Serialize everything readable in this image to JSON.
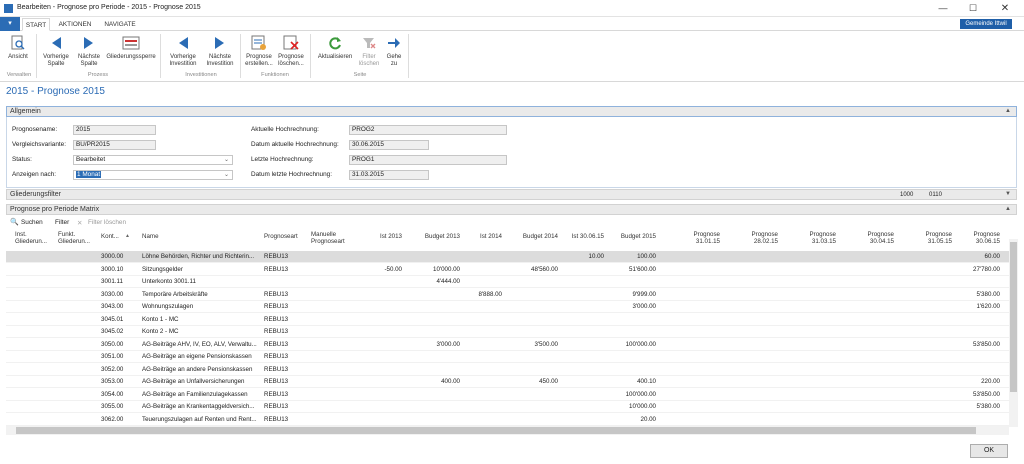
{
  "window": {
    "title": "Bearbeiten - Prognose pro Periode - 2015 - Prognose 2015"
  },
  "ribbon": {
    "tabs": [
      "START",
      "AKTIONEN",
      "NAVIGATE"
    ],
    "company": "Gemeinde Ittwil",
    "buttons": {
      "ansicht": "Ansicht",
      "vorherige_spalte": [
        "Vorherige",
        "Spalte"
      ],
      "naechste_spalte": [
        "Nächste",
        "Spalte"
      ],
      "gliederungssperre": "Gliederungssperre",
      "vorherige_investition": [
        "Vorherige",
        "Investition"
      ],
      "naechste_investition": [
        "Nächste",
        "Investition"
      ],
      "prognose_erstellen": [
        "Prognose",
        "erstellen..."
      ],
      "prognose_loeschen": [
        "Prognose",
        "löschen..."
      ],
      "aktualisieren": "Aktualisieren",
      "filter_loeschen": [
        "Filter",
        "löschen"
      ],
      "gehe_zu": [
        "Gehe",
        "zu"
      ]
    },
    "groups": {
      "verwalten": "Verwalten",
      "prozess": "Prozess",
      "investitionen": "Investitionen",
      "funktionen": "Funktionen",
      "seite": "Seite"
    }
  },
  "page": {
    "title": "2015 - Prognose 2015"
  },
  "allgemein": {
    "section_label": "Allgemein",
    "prognosename_label": "Prognosename:",
    "prognosename": "2015",
    "vergleich_label": "Vergleichsvariante:",
    "vergleich": "BU/PR2015",
    "status_label": "Status:",
    "status": "Bearbeitet",
    "anzeigen_label": "Anzeigen nach:",
    "anzeigen": "1 Monat",
    "aktuelle_label": "Aktuelle Hochrechnung:",
    "aktuelle": "PROG2",
    "datum_aktuelle_label": "Datum aktuelle Hochrechnung:",
    "datum_aktuelle": "30.06.2015",
    "letzte_label": "Letzte Hochrechnung:",
    "letzte": "PROG1",
    "datum_letzte_label": "Datum letzte Hochrechnung:",
    "datum_letzte": "31.03.2015"
  },
  "gliederungsfilter": {
    "label": "Gliederungsfilter",
    "value1": "1000",
    "value2": "0110"
  },
  "matrix": {
    "label": "Prognose pro Periode Matrix",
    "toolbar": {
      "suchen": "Suchen",
      "filter": "Filter",
      "filter_loeschen": "Filter löschen"
    },
    "headers": [
      "Inst. Gliederun...",
      "Funkt. Gliederun...",
      "Kont...",
      "Name",
      "Prognoseart",
      "Manuelle Prognoseart",
      "Ist 2013",
      "Budget 2013",
      "Ist 2014",
      "Budget 2014",
      "Ist 30.06.15",
      "Budget 2015",
      "Prognose 31.01.15",
      "Prognose 28.02.15",
      "Prognose 31.03.15",
      "Prognose 30.04.15",
      "Prognose 31.05.15",
      "Prognose 30.06.15"
    ],
    "rows": [
      {
        "konto": "3000.00",
        "name": "Löhne Behörden, Richter und Richterin...",
        "art": "REBU13",
        "ist13": "",
        "bud13": "",
        "ist14": "",
        "bud14": "",
        "ist15": "10.00",
        "bud15": "100.00",
        "p0615": "60.00",
        "hl": true
      },
      {
        "konto": "3000.10",
        "name": "Sitzungsgelder",
        "art": "REBU13",
        "ist13": "-50.00",
        "bud13": "10'000.00",
        "ist14": "",
        "bud14": "48'560.00",
        "ist15": "",
        "bud15": "51'600.00",
        "p0615": "27'780.00"
      },
      {
        "konto": "3001.11",
        "name": "Unterkonto 3001.11",
        "art": "",
        "ist13": "",
        "bud13": "4'444.00",
        "ist14": "",
        "bud14": "",
        "ist15": "",
        "bud15": "",
        "p0615": ""
      },
      {
        "konto": "3030.00",
        "name": "Temporäre Arbeitskräfte",
        "art": "REBU13",
        "ist13": "",
        "bud13": "",
        "ist14": "8'888.00",
        "bud14": "",
        "ist15": "",
        "bud15": "9'999.00",
        "p0615": "5'380.00"
      },
      {
        "konto": "3043.00",
        "name": "Wohnungszulagen",
        "art": "REBU13",
        "ist13": "",
        "bud13": "",
        "ist14": "",
        "bud14": "",
        "ist15": "",
        "bud15": "3'000.00",
        "p0615": "1'620.00"
      },
      {
        "konto": "3045.01",
        "name": "Konto 1 - MC",
        "art": "REBU13",
        "ist13": "",
        "bud13": "",
        "ist14": "",
        "bud14": "",
        "ist15": "",
        "bud15": "",
        "p0615": ""
      },
      {
        "konto": "3045.02",
        "name": "Konto 2 - MC",
        "art": "REBU13",
        "ist13": "",
        "bud13": "",
        "ist14": "",
        "bud14": "",
        "ist15": "",
        "bud15": "",
        "p0615": ""
      },
      {
        "konto": "3050.00",
        "name": "AG-Beiträge AHV, IV, EO, ALV, Verwaltu...",
        "art": "REBU13",
        "ist13": "",
        "bud13": "3'000.00",
        "ist14": "",
        "bud14": "3'500.00",
        "ist15": "",
        "bud15": "100'000.00",
        "p0615": "53'850.00"
      },
      {
        "konto": "3051.00",
        "name": "AG-Beiträge an eigene Pensionskassen",
        "art": "REBU13",
        "ist13": "",
        "bud13": "",
        "ist14": "",
        "bud14": "",
        "ist15": "",
        "bud15": "",
        "p0615": ""
      },
      {
        "konto": "3052.00",
        "name": "AG-Beiträge an andere Pensionskassen",
        "art": "REBU13",
        "ist13": "",
        "bud13": "",
        "ist14": "",
        "bud14": "",
        "ist15": "",
        "bud15": "",
        "p0615": ""
      },
      {
        "konto": "3053.00",
        "name": "AG-Beiträge an Unfallversicherungen",
        "art": "REBU13",
        "ist13": "",
        "bud13": "400.00",
        "ist14": "",
        "bud14": "450.00",
        "ist15": "",
        "bud15": "400.10",
        "p0615": "220.00"
      },
      {
        "konto": "3054.00",
        "name": "AG-Beiträge an Familienzulagekassen",
        "art": "REBU13",
        "ist13": "",
        "bud13": "",
        "ist14": "",
        "bud14": "",
        "ist15": "",
        "bud15": "100'000.00",
        "p0615": "53'850.00"
      },
      {
        "konto": "3055.00",
        "name": "AG-Beiträge an Krankentaggeldversich...",
        "art": "REBU13",
        "ist13": "",
        "bud13": "",
        "ist14": "",
        "bud14": "",
        "ist15": "",
        "bud15": "10'000.00",
        "p0615": "5'380.00"
      },
      {
        "konto": "3062.00",
        "name": "Teuerungszulagen auf Renten und Rent...",
        "art": "REBU13",
        "ist13": "",
        "bud13": "",
        "ist14": "",
        "bud14": "",
        "ist15": "",
        "bud15": "20.00",
        "p0615": ""
      }
    ]
  },
  "footer": {
    "ok": "OK"
  },
  "colors": {
    "accent": "#2b6cb5",
    "title_blue": "#2a6ab4",
    "highlight_row": "#dcdcdc"
  }
}
